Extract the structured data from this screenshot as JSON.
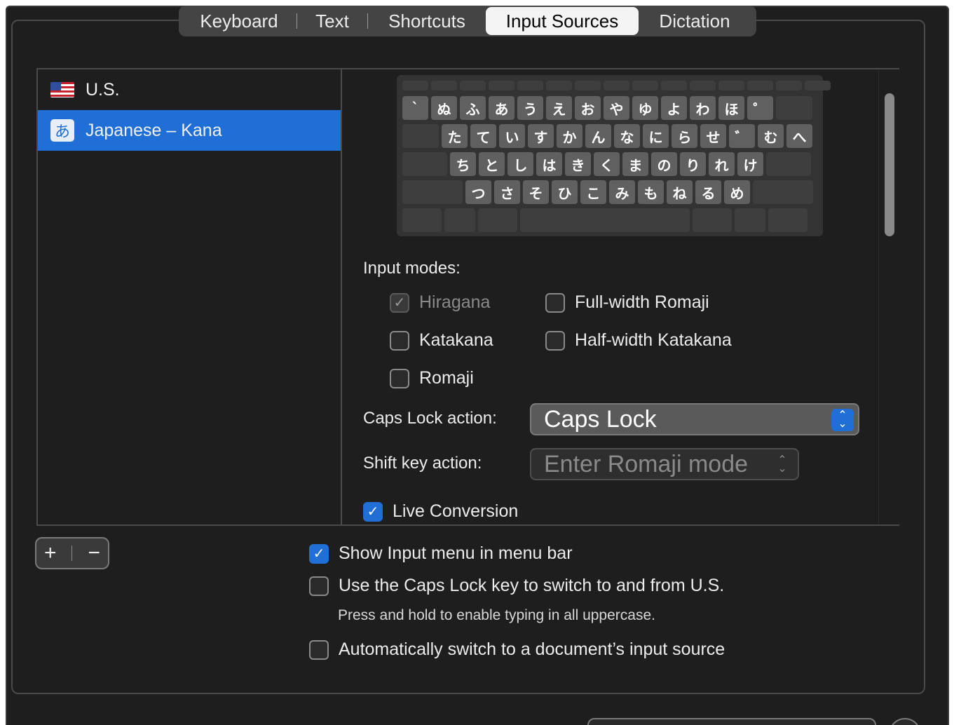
{
  "tabs": [
    {
      "label": "Keyboard",
      "active": false
    },
    {
      "label": "Text",
      "active": false
    },
    {
      "label": "Shortcuts",
      "active": false
    },
    {
      "label": "Input Sources",
      "active": true
    },
    {
      "label": "Dictation",
      "active": false
    }
  ],
  "sources": [
    {
      "label": "U.S.",
      "icon": "us-flag-icon",
      "selected": false
    },
    {
      "label": "Japanese – Kana",
      "icon": "japanese-kana-icon",
      "icon_glyph": "あ",
      "selected": true
    }
  ],
  "keyboard": {
    "row1": [
      "`",
      "ぬ",
      "ふ",
      "あ",
      "う",
      "え",
      "お",
      "や",
      "ゆ",
      "よ",
      "わ",
      "ほ",
      "゜"
    ],
    "row2": [
      "た",
      "て",
      "い",
      "す",
      "か",
      "ん",
      "な",
      "に",
      "ら",
      "せ",
      "゛",
      "む",
      "へ"
    ],
    "row3": [
      "ち",
      "と",
      "し",
      "は",
      "き",
      "く",
      "ま",
      "の",
      "り",
      "れ",
      "け"
    ],
    "row4": [
      "つ",
      "さ",
      "そ",
      "ひ",
      "こ",
      "み",
      "も",
      "ね",
      "る",
      "め"
    ]
  },
  "input_modes": {
    "title": "Input modes:",
    "hiragana": {
      "label": "Hiragana",
      "checked": true,
      "disabled": true
    },
    "katakana": {
      "label": "Katakana",
      "checked": false
    },
    "romaji": {
      "label": "Romaji",
      "checked": false
    },
    "full_width_romaji": {
      "label": "Full-width Romaji",
      "checked": false
    },
    "half_width_katakana": {
      "label": "Half-width Katakana",
      "checked": false
    }
  },
  "caps_lock_action": {
    "label": "Caps Lock action:",
    "value": "Caps Lock"
  },
  "shift_key_action": {
    "label": "Shift key action:",
    "value": "Enter Romaji mode"
  },
  "live_conversion": {
    "label": "Live Conversion",
    "checked": true
  },
  "buttons": {
    "add": "+",
    "remove": "−"
  },
  "options": {
    "show_input_menu": {
      "label": "Show Input menu in menu bar",
      "checked": true
    },
    "caps_lock_switch": {
      "label": "Use the Caps Lock key to switch to and from U.S.",
      "checked": false
    },
    "caps_lock_hint": "Press and hold to enable typing in all uppercase.",
    "auto_switch": {
      "label": "Automatically switch to a document’s input source",
      "checked": false
    }
  },
  "glyphs": {
    "check": "✓",
    "up": "▲",
    "down": "▼",
    "up_small": "⌃",
    "down_small": "⌄"
  },
  "colors": {
    "accent": "#1f6fd6",
    "background": "#1e1e1e"
  }
}
